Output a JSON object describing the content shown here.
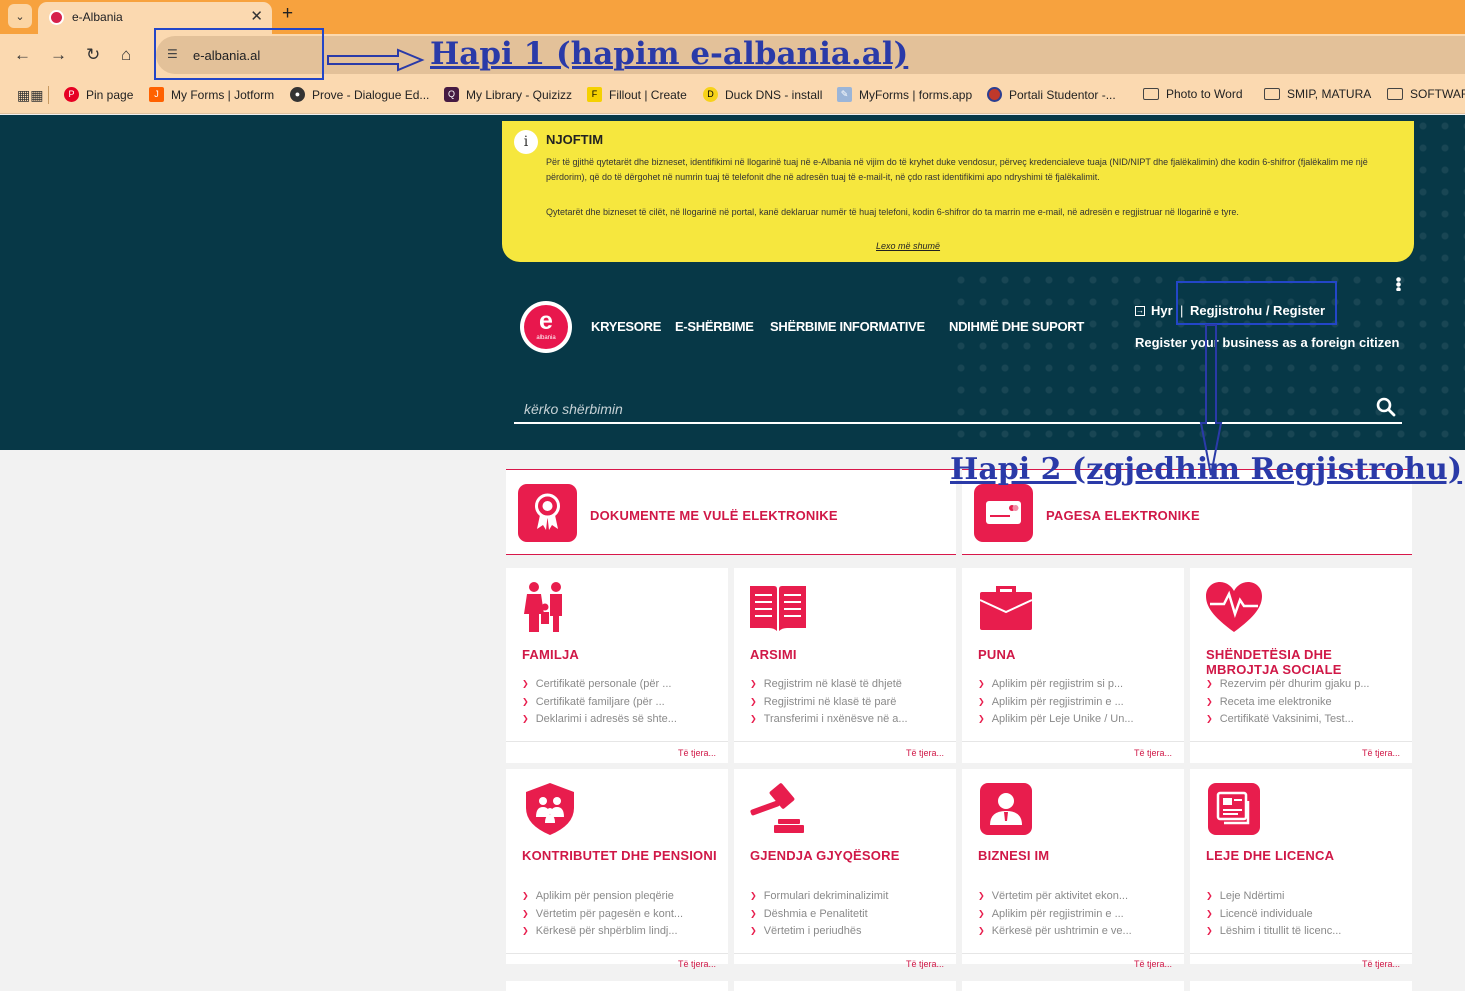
{
  "browser": {
    "tab_title": "e-Albania",
    "url": "e-albania.al",
    "bookmarks": [
      {
        "label": "Pin page",
        "icon": "pinterest-icon"
      },
      {
        "label": "My Forms | Jotform",
        "icon": "jotform-icon"
      },
      {
        "label": "Prove - Dialogue Ed...",
        "icon": "globe-icon"
      },
      {
        "label": "My Library - Quizizz",
        "icon": "quizizz-icon"
      },
      {
        "label": "Fillout | Create",
        "icon": "fillout-icon"
      },
      {
        "label": "Duck DNS - install",
        "icon": "duck-icon"
      },
      {
        "label": "MyForms | forms.app",
        "icon": "formsapp-icon"
      },
      {
        "label": "Portali Studentor -...",
        "icon": "portal-icon"
      },
      {
        "label": "Photo to Word",
        "icon": "folder-icon"
      },
      {
        "label": "SMIP, MATURA",
        "icon": "folder-icon"
      },
      {
        "label": "SOFTWAR",
        "icon": "folder-icon"
      }
    ]
  },
  "notice": {
    "title": "NJOFTIM",
    "paragraph1": "Për të gjithë qytetarët dhe bizneset, identifikimi në llogarinë tuaj në e-Albania në vijim do të kryhet duke vendosur, përveç kredencialeve tuaja (NID/NIPT dhe fjalëkalimin) dhe kodin 6-shifror (fjalëkalim me një përdorim), që do të dërgohet në numrin tuaj të telefonit dhe në adresën tuaj të e-mail-it, në çdo rast identifikimi apo ndryshimi të fjalëkalimit.",
    "paragraph2": "Qytetarët dhe bizneset të cilët, në llogarinë në portal, kanë deklaruar numër të huaj telefoni, kodin 6-shifror do ta marrin me e-mail, në adresën e regjistruar në llogarinë e tyre.",
    "read_more": "Lexo më shumë"
  },
  "header": {
    "logo_letter": "e",
    "logo_sub": "albania",
    "menu": [
      "KRYESORE",
      "E-SHËRBIME",
      "SHËRBIME INFORMATIVE",
      "NDIHMË DHE SUPORT"
    ],
    "login": "Hyr",
    "separator": "|",
    "register": "Regjistrohu / Register",
    "foreign": "Register your business as a foreign citizen"
  },
  "search": {
    "placeholder": "kërko shërbimin"
  },
  "features": [
    {
      "label": "DOKUMENTE ME VULË ELEKTRONIKE",
      "icon": "seal-badge-icon"
    },
    {
      "label": "PAGESA ELEKTRONIKE",
      "icon": "credit-card-icon"
    }
  ],
  "categories": [
    {
      "title": "FAMILJA",
      "icon": "family-icon",
      "items": [
        "Certifikatë personale (për ...",
        "Certifikatë familjare (për ...",
        "Deklarimi i adresës së shte..."
      ],
      "more": "Të tjera..."
    },
    {
      "title": "ARSIMI",
      "icon": "book-icon",
      "items": [
        "Regjistrim në klasë të dhjetë",
        "Regjistrimi në klasë të parë",
        "Transferimi i nxënësve në a..."
      ],
      "more": "Të tjera..."
    },
    {
      "title": "PUNA",
      "icon": "briefcase-icon",
      "items": [
        "Aplikim për regjistrim si p...",
        "Aplikim për regjistrimin e ...",
        "Aplikim për Leje Unike / Un..."
      ],
      "more": "Të tjera..."
    },
    {
      "title": "SHËNDETËSIA DHE MBROJTJA SOCIALE",
      "icon": "heart-pulse-icon",
      "items": [
        "Rezervim për dhurim gjaku p...",
        "Receta ime elektronike",
        "Certifikatë Vaksinimi, Test..."
      ],
      "more": "Të tjera..."
    },
    {
      "title": "KONTRIBUTET DHE PENSIONI",
      "icon": "shield-family-icon",
      "items": [
        "Aplikim për pension pleqërie",
        "Vërtetim për pagesën e kont...",
        "Kërkesë për shpërblim lindj..."
      ],
      "more": "Të tjera..."
    },
    {
      "title": "GJENDJA GJYQËSORE",
      "icon": "gavel-icon",
      "items": [
        "Formulari dekriminalizimit",
        "Dëshmia e Penalitetit",
        "Vërtetim i periudhës"
      ],
      "more": "Të tjera..."
    },
    {
      "title": "BIZNESI IM",
      "icon": "business-person-icon",
      "items": [
        "Vërtetim për aktivitet ekon...",
        "Aplikim për regjistrimin e ...",
        "Kërkesë për ushtrimin e ve..."
      ],
      "more": "Të tjera..."
    },
    {
      "title": "LEJE DHE LICENCA",
      "icon": "license-icon",
      "items": [
        "Leje Ndërtimi",
        "Licencë individuale",
        "Lëshim i titullit të licenc..."
      ],
      "more": "Të tjera..."
    }
  ],
  "annotations": {
    "step1": "Hapi 1 (hapim e-albania.al)",
    "step2": "Hapi 2 (zgjedhim Regjistrohu)"
  }
}
